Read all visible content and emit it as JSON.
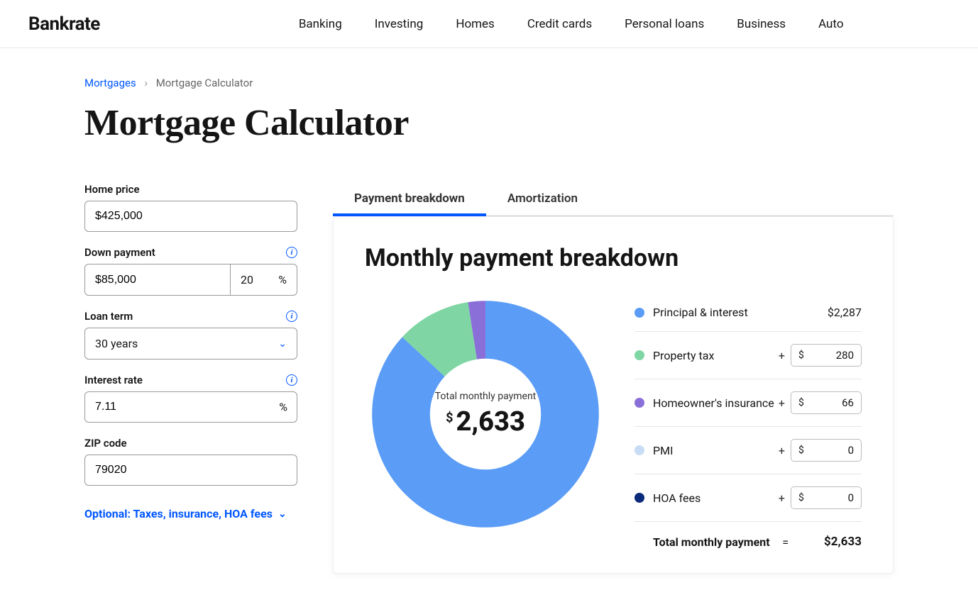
{
  "brand": "Bankrate",
  "nav": [
    "Banking",
    "Investing",
    "Homes",
    "Credit cards",
    "Personal loans",
    "Business",
    "Auto"
  ],
  "breadcrumb": {
    "parent": "Mortgages",
    "current": "Mortgage Calculator"
  },
  "page_title": "Mortgage Calculator",
  "form": {
    "home_price": {
      "label": "Home price",
      "value": "$425,000"
    },
    "down_payment": {
      "label": "Down payment",
      "value": "$85,000",
      "pct": "20",
      "pct_suffix": "%"
    },
    "loan_term": {
      "label": "Loan term",
      "value": "30 years"
    },
    "interest_rate": {
      "label": "Interest rate",
      "value": "7.11",
      "suffix": "%"
    },
    "zip": {
      "label": "ZIP code",
      "value": "79020"
    },
    "optional_toggle": "Optional: Taxes, insurance, HOA fees"
  },
  "tabs": {
    "active": "Payment breakdown",
    "other": "Amortization"
  },
  "breakdown": {
    "heading": "Monthly payment breakdown",
    "center_label": "Total monthly payment",
    "center_value": "2,633",
    "items": [
      {
        "label": "Principal & interest",
        "value_display": "$2,287",
        "color": "#5b9cf6",
        "editable": false
      },
      {
        "label": "Property tax",
        "value_display": "280",
        "color": "#7fd6a4",
        "editable": true
      },
      {
        "label": "Homeowner's insurance",
        "value_display": "66",
        "color": "#8a6fd9",
        "editable": true
      },
      {
        "label": "PMI",
        "value_display": "0",
        "color": "#c9dcf5",
        "editable": true
      },
      {
        "label": "HOA fees",
        "value_display": "0",
        "color": "#0b2a7a",
        "editable": true
      }
    ],
    "total_label": "Total monthly payment",
    "total_value": "$2,633"
  },
  "chart_data": {
    "type": "pie",
    "title": "Monthly payment breakdown",
    "series": [
      {
        "name": "Principal & interest",
        "value": 2287,
        "color": "#5b9cf6"
      },
      {
        "name": "Property tax",
        "value": 280,
        "color": "#7fd6a4"
      },
      {
        "name": "Homeowner's insurance",
        "value": 66,
        "color": "#8a6fd9"
      },
      {
        "name": "PMI",
        "value": 0,
        "color": "#c9dcf5"
      },
      {
        "name": "HOA fees",
        "value": 0,
        "color": "#0b2a7a"
      }
    ],
    "total": 2633
  }
}
